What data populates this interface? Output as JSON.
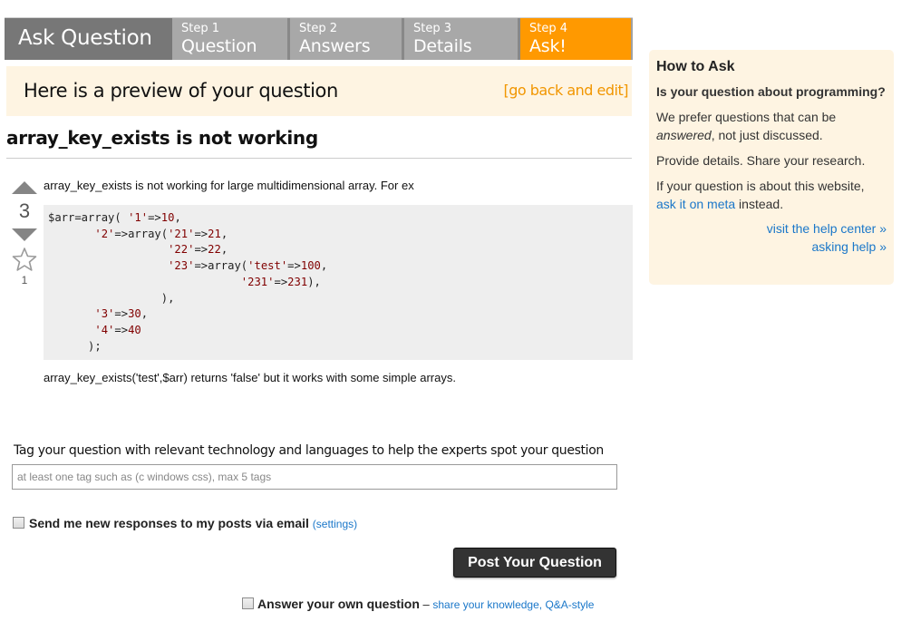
{
  "header": {
    "title": "Ask Question",
    "steps": [
      {
        "num": "Step 1",
        "label": "Question"
      },
      {
        "num": "Step 2",
        "label": "Answers"
      },
      {
        "num": "Step 3",
        "label": "Details"
      },
      {
        "num": "Step 4",
        "label": "Ask!"
      }
    ],
    "active_step": 4
  },
  "preview": {
    "title": "Here is a preview of your question",
    "edit_link": "[go back and edit]"
  },
  "question": {
    "title": "array_key_exists is not working",
    "votes": "3",
    "favorites": "1",
    "intro": "array_key_exists is not working for large multidimensional array. For ex",
    "code_lines": [
      [
        {
          "t": "$arr=array( "
        },
        {
          "t": "'1'",
          "s": 1
        },
        {
          "t": "=>"
        },
        {
          "t": "10",
          "s": 1
        },
        {
          "t": ","
        }
      ],
      [
        {
          "t": "       "
        },
        {
          "t": "'2'",
          "s": 1
        },
        {
          "t": "=>array("
        },
        {
          "t": "'21'",
          "s": 1
        },
        {
          "t": "=>"
        },
        {
          "t": "21",
          "s": 1
        },
        {
          "t": ","
        }
      ],
      [
        {
          "t": "                  "
        },
        {
          "t": "'22'",
          "s": 1
        },
        {
          "t": "=>"
        },
        {
          "t": "22",
          "s": 1
        },
        {
          "t": ","
        }
      ],
      [
        {
          "t": "                  "
        },
        {
          "t": "'23'",
          "s": 1
        },
        {
          "t": "=>array("
        },
        {
          "t": "'test'",
          "s": 1
        },
        {
          "t": "=>"
        },
        {
          "t": "100",
          "s": 1
        },
        {
          "t": ","
        }
      ],
      [
        {
          "t": "                             "
        },
        {
          "t": "'231'",
          "s": 1
        },
        {
          "t": "=>"
        },
        {
          "t": "231",
          "s": 1
        },
        {
          "t": "),"
        }
      ],
      [
        {
          "t": "                 ),"
        }
      ],
      [
        {
          "t": "       "
        },
        {
          "t": "'3'",
          "s": 1
        },
        {
          "t": "=>"
        },
        {
          "t": "30",
          "s": 1
        },
        {
          "t": ","
        }
      ],
      [
        {
          "t": "       "
        },
        {
          "t": "'4'",
          "s": 1
        },
        {
          "t": "=>"
        },
        {
          "t": "40",
          "s": 1
        }
      ],
      [
        {
          "t": "      );"
        }
      ]
    ],
    "outro": "array_key_exists('test',$arr) returns 'false' but it works with some simple arrays."
  },
  "tags": {
    "label": "Tag your question with relevant technology and languages to help the experts spot your question",
    "value": "",
    "placeholder": "at least one tag such as (c windows css), max 5 tags"
  },
  "email_option": {
    "label": "Send me new responses to my posts via email",
    "settings_link": "(settings)",
    "checked": false
  },
  "post_button": "Post Your Question",
  "answer_own": {
    "label": "Answer your own question",
    "dash": " – ",
    "link": "share your knowledge, Q&A-style",
    "checked": false
  },
  "sidebar": {
    "title": "How to Ask",
    "subtitle": "Is your question about programming?",
    "p1_pre": "We prefer questions that can be ",
    "p1_em": "answered",
    "p1_post": ", not just discussed.",
    "p2": "Provide details. Share your research.",
    "p3_pre": "If your question is about this website, ",
    "p3_link": "ask it on meta",
    "p3_post": " instead.",
    "links": [
      "visit the help center »",
      "asking help »"
    ]
  },
  "colors": {
    "accent": "#ff9900",
    "link": "#1a77c9",
    "banner_bg": "#fef4e2",
    "code_string": "#800000"
  }
}
